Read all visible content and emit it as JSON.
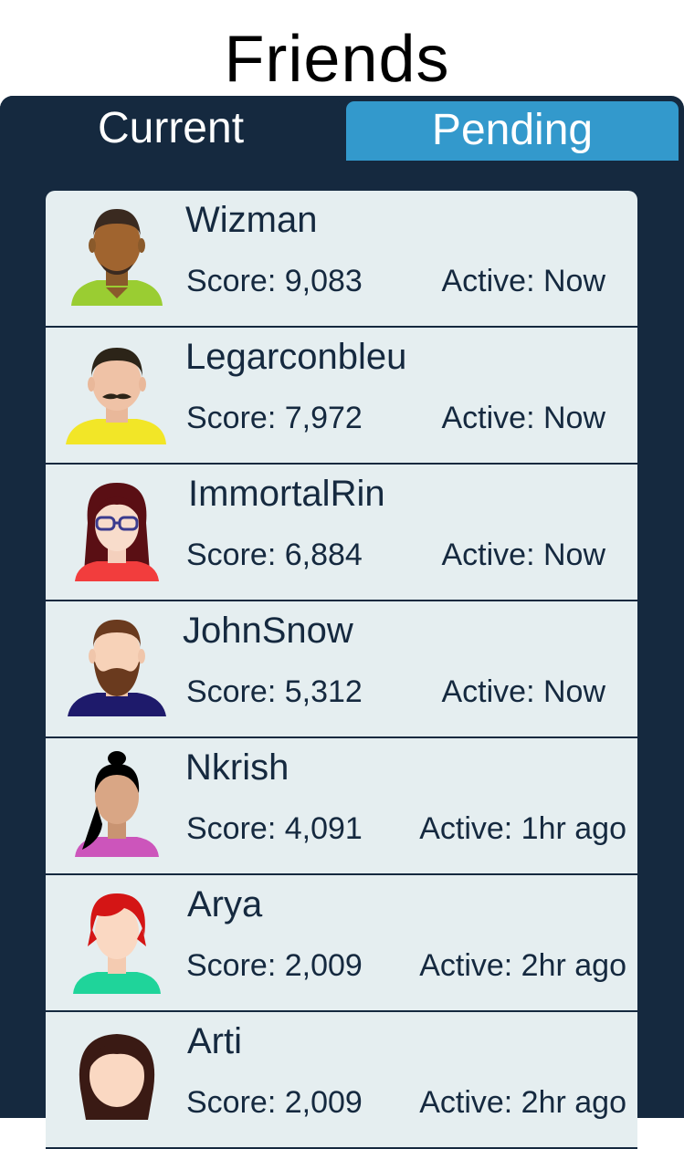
{
  "page": {
    "title": "Friends"
  },
  "tabs": {
    "current": "Current",
    "pending": "Pending"
  },
  "friends": [
    {
      "name": "Wizman",
      "score": "Score: 9,083",
      "active": "Active: Now",
      "avatar": "man-dark-skin-green-shirt-avatar-icon"
    },
    {
      "name": "Legarconbleu",
      "score": "Score: 7,972",
      "active": "Active: Now",
      "avatar": "man-mustache-yellow-shirt-avatar-icon"
    },
    {
      "name": "ImmortalRin",
      "score": "Score: 6,884",
      "active": "Active: Now",
      "avatar": "woman-glasses-red-top-avatar-icon"
    },
    {
      "name": "JohnSnow",
      "score": "Score: 5,312",
      "active": "Active: Now",
      "avatar": "man-beard-navy-shirt-avatar-icon"
    },
    {
      "name": "Nkrish",
      "score": "Score: 4,091",
      "active": "Active: 1hr ago",
      "avatar": "woman-ponytail-pink-top-avatar-icon"
    },
    {
      "name": "Arya",
      "score": "Score: 2,009",
      "active": "Active: 2hr ago",
      "avatar": "woman-red-hair-teal-top-avatar-icon"
    },
    {
      "name": "Arti",
      "score": "Score: 2,009",
      "active": "Active: 2hr ago",
      "avatar": "woman-dark-hair-avatar-icon"
    }
  ],
  "colors": {
    "panel": "#15293f",
    "pending_tab": "#3399cc",
    "row_background": "#e5eef0",
    "text_dark": "#15293f"
  }
}
